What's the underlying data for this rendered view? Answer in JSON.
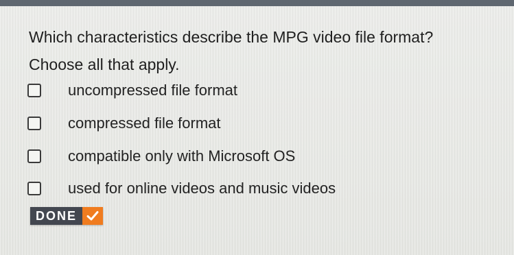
{
  "colors": {
    "top_bar": "#5f6770",
    "done_bg": "#434750",
    "done_accent": "#f07c1f"
  },
  "question": {
    "text": "Which characteristics describe the MPG video file format? Choose all that apply."
  },
  "options": [
    {
      "label": "uncompressed file format",
      "checked": false
    },
    {
      "label": "compressed file format",
      "checked": false
    },
    {
      "label": "compatible only with Microsoft OS",
      "checked": false
    },
    {
      "label": "used for online videos and music videos",
      "checked": false
    }
  ],
  "done_button": {
    "label": "DONE",
    "icon": "checkmark-icon"
  }
}
